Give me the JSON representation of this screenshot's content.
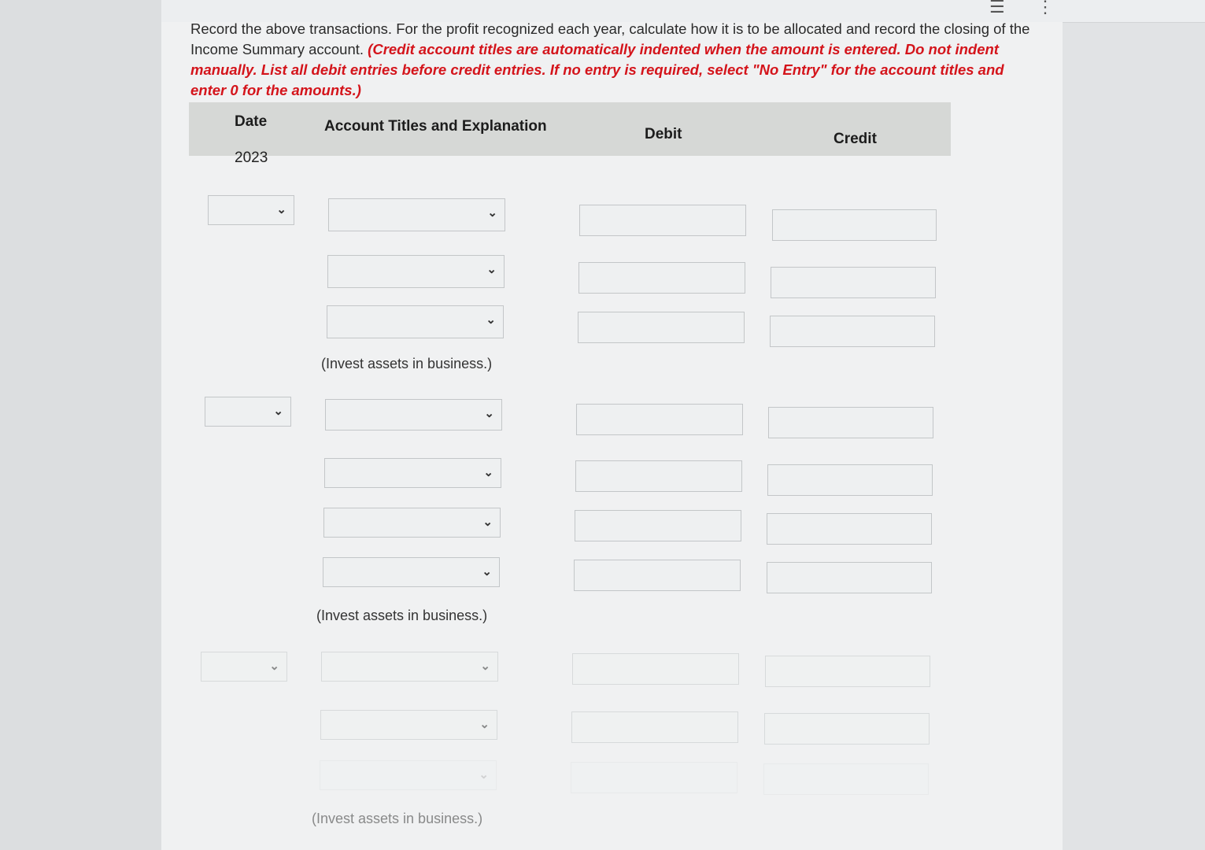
{
  "instructions": {
    "plain": "Record the above transactions. For the profit recognized each year, calculate how it is to be allocated and record the closing of the Income Summary account. ",
    "emphasis": "(Credit account titles are automatically indented when the amount is entered. Do not indent manually. List all debit entries before credit entries. If no entry is required, select \"No Entry\" for the account titles and enter 0 for the amounts.)"
  },
  "table": {
    "headers": {
      "date": "Date",
      "account": "Account Titles and Explanation",
      "debit": "Debit",
      "credit": "Credit"
    },
    "year": "2023"
  },
  "entries": [
    {
      "explanation": "(Invest assets in business.)"
    },
    {
      "explanation": "(Invest assets in business.)"
    },
    {
      "explanation": "(Invest assets in business.)"
    }
  ],
  "icons": {
    "chevron": "chevron-down-icon",
    "list": "list-icon",
    "more": "more-vertical-icon"
  }
}
